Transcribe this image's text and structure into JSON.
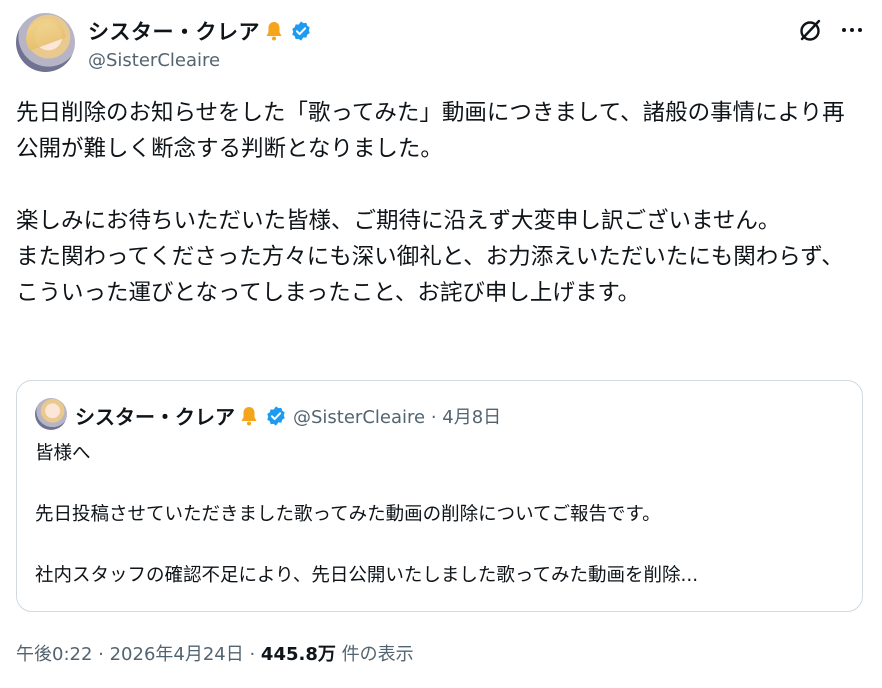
{
  "author": {
    "display_name": "シスター・クレア",
    "handle": "@SisterCleaire",
    "badge_icons": [
      "bell-icon",
      "verified-badge-icon"
    ]
  },
  "header_actions": {
    "grok_icon": "grok-icon",
    "more_icon": "more-icon"
  },
  "tweet": {
    "text": "先日削除のお知らせをした「歌ってみた」動画につきまして、諸般の事情により再公開が難しく断念する判断となりました。\n\n楽しみにお待ちいただいた皆様、ご期待に沿えず大変申し訳ございません。\nまた関わってくださった方々にも深い御礼と、お力添えいただいたにも関わらず、こういった運びとなってしまったこと、お詫び申し上げます。"
  },
  "quote": {
    "display_name": "シスター・クレア",
    "meta": "@SisterCleaire · 4月8日",
    "text": "皆様へ\n\n先日投稿させていただきました歌ってみた動画の削除についてご報告です。\n\n社内スタッフの確認不足により、先日公開いたしました歌ってみた動画を削除..."
  },
  "footer": {
    "time_date": "午後0:22 · 2026年4月24日 · ",
    "views_count": "445.8万",
    "views_label": " 件の表示"
  },
  "colors": {
    "text_primary": "#0f1419",
    "text_secondary": "#536471",
    "verified_blue": "#1d9bf0",
    "bell_orange": "#f4a51c",
    "border": "#cfd9de"
  }
}
